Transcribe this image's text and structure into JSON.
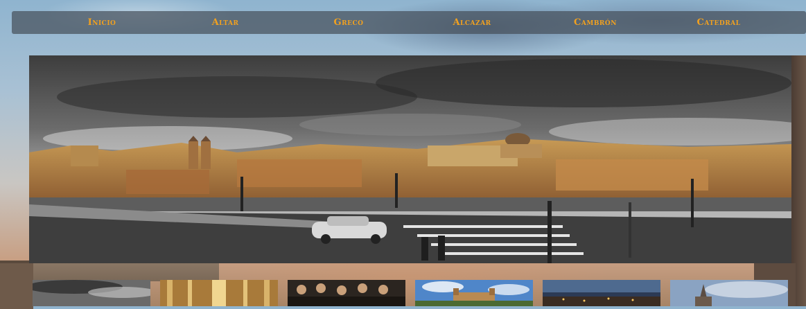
{
  "nav": {
    "items": [
      {
        "label": "Inicio"
      },
      {
        "label": "Altar"
      },
      {
        "label": "Greco"
      },
      {
        "label": "Alcazar"
      },
      {
        "label": "Cambrón"
      },
      {
        "label": "Catedral"
      }
    ]
  },
  "colors": {
    "nav_text": "#f2a11f",
    "nav_background": "rgba(70,80,92,0.72)"
  },
  "hero": {
    "image": "toledo-panorama-photo"
  },
  "thumbnails": [
    {
      "image": "toledo-panorama-thumbnail"
    },
    {
      "image": "cathedral-altar-thumbnail"
    },
    {
      "image": "greco-painting-thumbnail"
    },
    {
      "image": "alcazar-thumbnail"
    },
    {
      "image": "toledo-night-thumbnail"
    },
    {
      "image": "cathedral-tower-thumbnail"
    }
  ]
}
